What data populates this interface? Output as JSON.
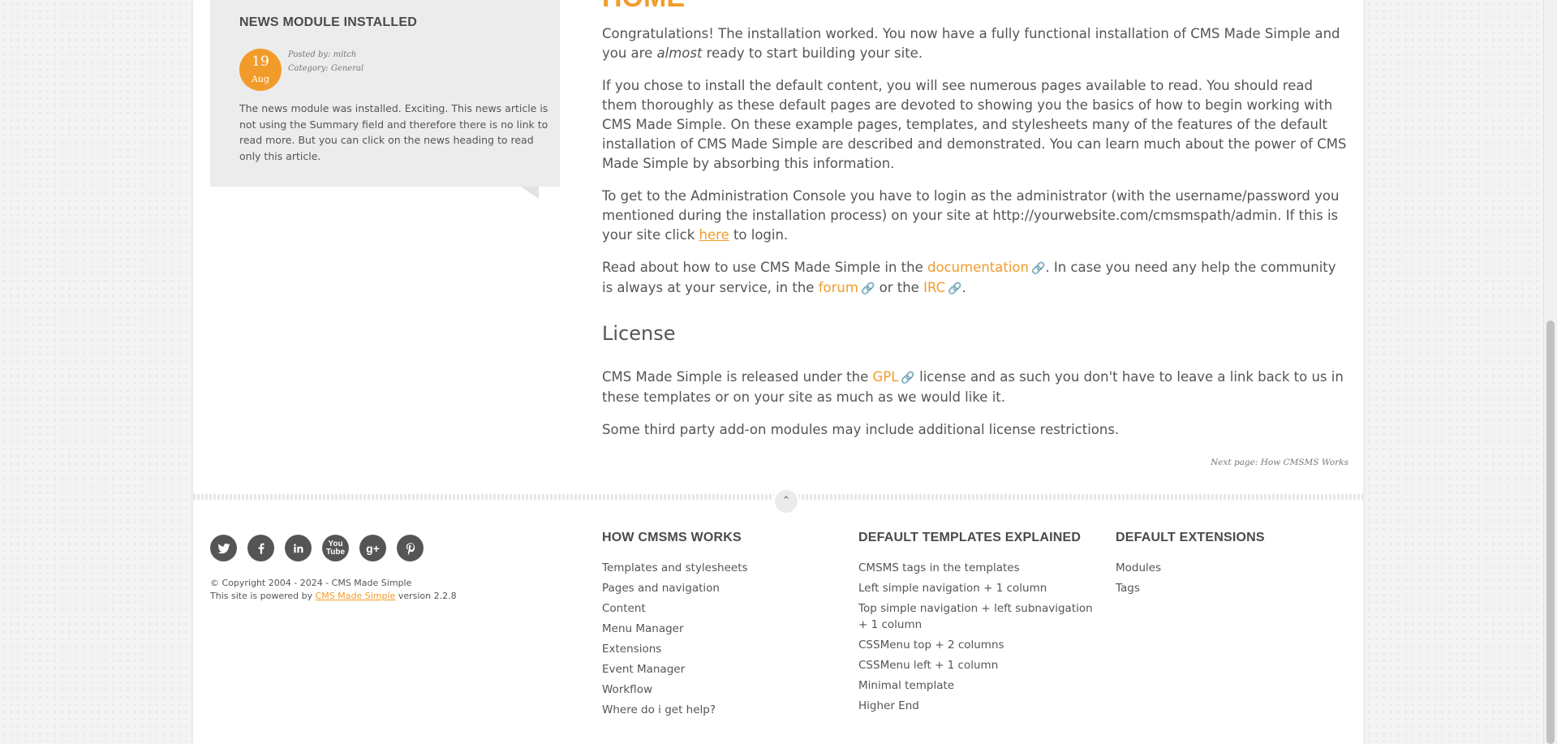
{
  "news": {
    "title": "NEWS MODULE INSTALLED",
    "day": "19",
    "month": "Aug",
    "posted_by": "Posted by: mitch",
    "category": "Category: General",
    "body": "The news module was installed. Exciting. This news article is not using the Summary field and therefore there is no link to read more. But you can click on the news heading to read only this article."
  },
  "main": {
    "title": "HOME",
    "p1_a": "Congratulations! The installation worked. You now have a fully functional installation of CMS Made Simple and you are",
    "p1_em": "almost",
    "p1_b": " ready to start building your site.",
    "p2": "If you chose to install the default content, you will see numerous pages available to read. You should read them thoroughly as these default pages are devoted to showing you the basics of how to begin working with CMS Made Simple. On these example pages, templates, and stylesheets many of the features of the default installation of CMS Made Simple are described and demonstrated. You can learn much about the power of CMS Made Simple by absorbing this information.",
    "p3_a": "To get to the Administration Console you have to login as the administrator (with the username/password you mentioned during the installation process) on your site at http://yourwebsite.com/cmsmspath/admin. If this is your site click ",
    "p3_link": "here",
    "p3_b": " to login.",
    "p4_a": "Read about how to use CMS Made Simple in the ",
    "p4_doc": "documentation",
    "p4_b": ". In case you need any help the community is always at your service, in the ",
    "p4_forum": "forum",
    "p4_c": " or the ",
    "p4_irc": "IRC",
    "p4_d": ".",
    "license_heading": "License",
    "p5_a": "CMS Made Simple is released under the ",
    "p5_gpl": "GPL",
    "p5_b": " license and as such you don't have to leave a link back to us in these templates or on your site as much as we would like it.",
    "p6": "Some third party add-on modules may include additional license restrictions.",
    "next_page": "Next page: How CMSMS Works"
  },
  "footer": {
    "social": [
      "twitter-icon",
      "facebook-icon",
      "linkedin-icon",
      "youtube-icon",
      "googleplus-icon",
      "pinterest-icon"
    ],
    "copyright": "© Copyright 2004 - 2024 - CMS Made Simple",
    "powered_a": "This site is powered by ",
    "powered_link": "CMS Made Simple",
    "powered_b": " version 2.2.8",
    "col1": {
      "title": "HOW CMSMS WORKS",
      "items": [
        "Templates and stylesheets",
        "Pages and navigation",
        "Content",
        "Menu Manager",
        "Extensions",
        "Event Manager",
        "Workflow",
        "Where do i get help?"
      ]
    },
    "col2": {
      "title": "DEFAULT TEMPLATES EXPLAINED",
      "items": [
        "CMSMS tags in the templates",
        "Left simple navigation + 1 column",
        "Top simple navigation + left subnavigation + 1 column",
        "CSSMenu top + 2 columns",
        "CSSMenu left + 1 column",
        "Minimal template",
        "Higher End"
      ]
    },
    "col3": {
      "title": "DEFAULT EXTENSIONS",
      "items": [
        "Modules",
        "Tags"
      ]
    }
  },
  "colors": {
    "accent": "#f19c2a",
    "text": "#555555",
    "social_bg": "#555555"
  }
}
